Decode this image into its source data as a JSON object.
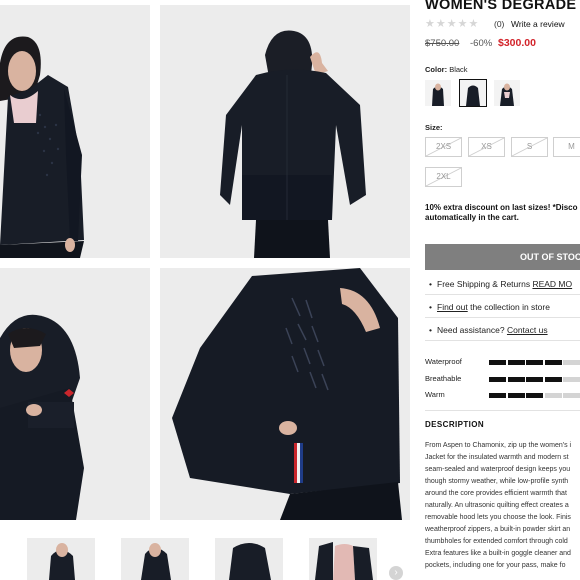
{
  "product": {
    "title": "WOMEN'S DEGRADE S",
    "rating_stars": "★★★★★",
    "review_count": "(0)",
    "write_review": "Write a review",
    "price_old": "$750.00",
    "price_discount": "-60%",
    "price_new": "$300.00"
  },
  "color": {
    "label": "Color:",
    "value": "Black",
    "swatches": [
      "swatch-front",
      "swatch-back",
      "swatch-hood"
    ],
    "selected_index": 1
  },
  "size": {
    "label": "Size:",
    "options": [
      "2XS",
      "XS",
      "S",
      "M",
      "2XL"
    ],
    "unavailable": [
      true,
      true,
      true,
      false,
      true
    ]
  },
  "discount_text": [
    "10% extra discount on last sizes! *Disco",
    "automatically in the cart."
  ],
  "cta": {
    "label": "OUT OF STOC"
  },
  "info": {
    "shipping_text": "Free Shipping & Returns",
    "shipping_link": "READ MO",
    "store_link": "Find out",
    "store_text": "the collection in store",
    "assist_text": "Need assistance?",
    "assist_link": "Contact us"
  },
  "features": [
    {
      "label": "Waterproof",
      "level": 0.8
    },
    {
      "label": "Breathable",
      "level": 0.8
    },
    {
      "label": "Warm",
      "level": 0.6
    }
  ],
  "description": {
    "title": "DESCRIPTION",
    "lines": [
      "From Aspen to Chamonix, zip up the women's i",
      "Jacket for the insulated warmth and modern st",
      "seam-sealed and waterproof design keeps you",
      "though stormy weather, while low-profile synth",
      "around the core provides efficient warmth that",
      "naturally. An ultrasonic quilting effect creates a",
      "removable hood lets you choose the look. Finis",
      "weatherproof zippers, a built-in powder skirt an",
      "thumbholes for extended comfort through cold",
      "Extra features like a built-in goggle cleaner and",
      "pockets, including one for your pass, make fo"
    ]
  },
  "gallery": {
    "next_icon": "›"
  },
  "colors": {
    "accent_red": "#d2232a",
    "cta_gray": "#7f7f7f",
    "jacket": "#181d27"
  }
}
